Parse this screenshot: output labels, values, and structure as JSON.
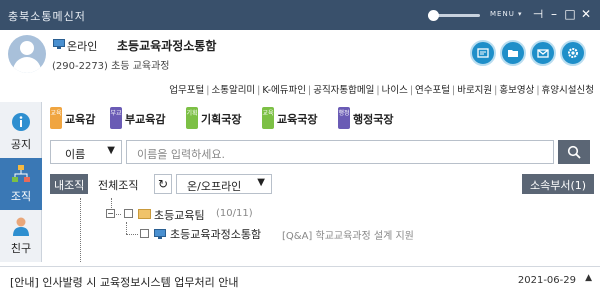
{
  "app": {
    "title": "충북소통메신저",
    "menu_label": "MENU"
  },
  "profile": {
    "status": "온라인",
    "name": "초등교육과정소통함",
    "extension": "(290-2273) 초등 교육과정"
  },
  "links": [
    "업무포털",
    "소통알리미",
    "K-에듀파인",
    "공직자통합메일",
    "나이스",
    "연수포털",
    "바로지원",
    "홍보영상",
    "휴양시설신청"
  ],
  "sidebar": [
    {
      "label": "공지"
    },
    {
      "label": "조직"
    },
    {
      "label": "친구"
    }
  ],
  "roles": [
    {
      "badge": "교육",
      "label": "교육감",
      "color": "#f0a540"
    },
    {
      "badge": "부교",
      "label": "부교육감",
      "color": "#6a5bb5"
    },
    {
      "badge": "기획",
      "label": "기획국장",
      "color": "#7cc045"
    },
    {
      "badge": "교육",
      "label": "교육국장",
      "color": "#7cc045"
    },
    {
      "badge": "행정",
      "label": "행정국장",
      "color": "#6a5bb5"
    }
  ],
  "search": {
    "field": "이름",
    "placeholder": "이름을 입력하세요."
  },
  "tabs": {
    "my_org": "내조직",
    "all_org": "전체조직",
    "online_filter": "온/오프라인",
    "sub_dept": "소속부서(1)"
  },
  "tree": {
    "team": "초등교육팀",
    "team_count": "(10/11)",
    "member": "초등교육과정소통함",
    "member_desc": "[Q&A] 학교교육과정 설계 지원"
  },
  "statusbar": {
    "notice": "[안내] 인사발령 시 교육정보시스템 업무처리 안내",
    "date": "2021-06-29"
  },
  "colors": {
    "titlebar": "#39506b",
    "accent": "#1f8fc9",
    "active_sidebar": "#3a78b5"
  }
}
